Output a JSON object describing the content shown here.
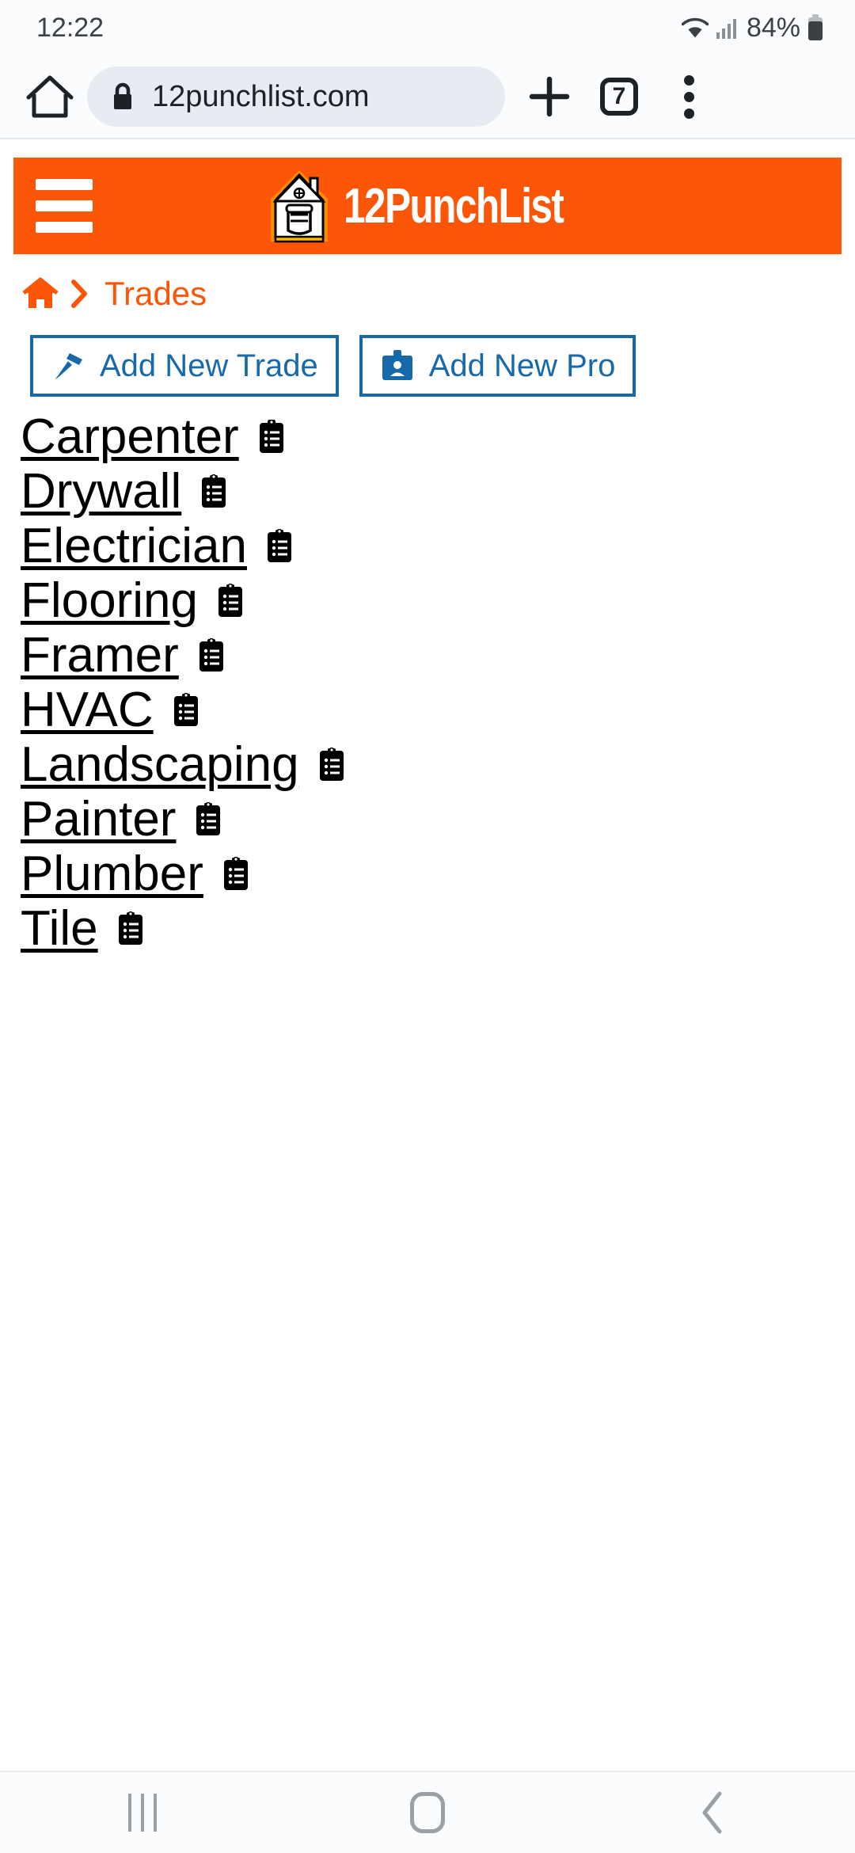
{
  "status_bar": {
    "time": "12:22",
    "battery_percent": "84%",
    "wifi_icon": "wifi-icon",
    "signal_icon": "cellular-signal-icon",
    "battery_icon": "battery-icon"
  },
  "browser": {
    "home_icon": "home-icon",
    "lock_icon": "lock-icon",
    "url": "12punchlist.com",
    "new_tab_icon": "plus-icon",
    "tab_count": "7",
    "menu_icon": "kebab-menu-icon"
  },
  "site_header": {
    "menu_icon": "hamburger-menu-icon",
    "logo_icon": "punchlist-house-fist-logo",
    "brand": "12PunchList",
    "background_color": "#fb5607"
  },
  "breadcrumb": {
    "home_icon": "home-icon",
    "separator_icon": "chevron-right-icon",
    "current": "Trades",
    "color": "#fb5607"
  },
  "actions": {
    "color": "#1769aa",
    "buttons": [
      {
        "label": "Add New Trade",
        "icon": "hammer-icon"
      },
      {
        "label": "Add New Pro",
        "icon": "id-badge-icon"
      }
    ]
  },
  "trades": {
    "item_icon": "clipboard-list-icon",
    "items": [
      {
        "name": "Carpenter"
      },
      {
        "name": "Drywall"
      },
      {
        "name": "Electrician"
      },
      {
        "name": "Flooring"
      },
      {
        "name": "Framer"
      },
      {
        "name": "HVAC"
      },
      {
        "name": "Landscaping"
      },
      {
        "name": "Painter"
      },
      {
        "name": "Plumber"
      },
      {
        "name": "Tile"
      }
    ]
  },
  "bottom_nav": {
    "recents_icon": "recents-icon",
    "home_icon": "home-button-icon",
    "back_icon": "back-icon"
  }
}
